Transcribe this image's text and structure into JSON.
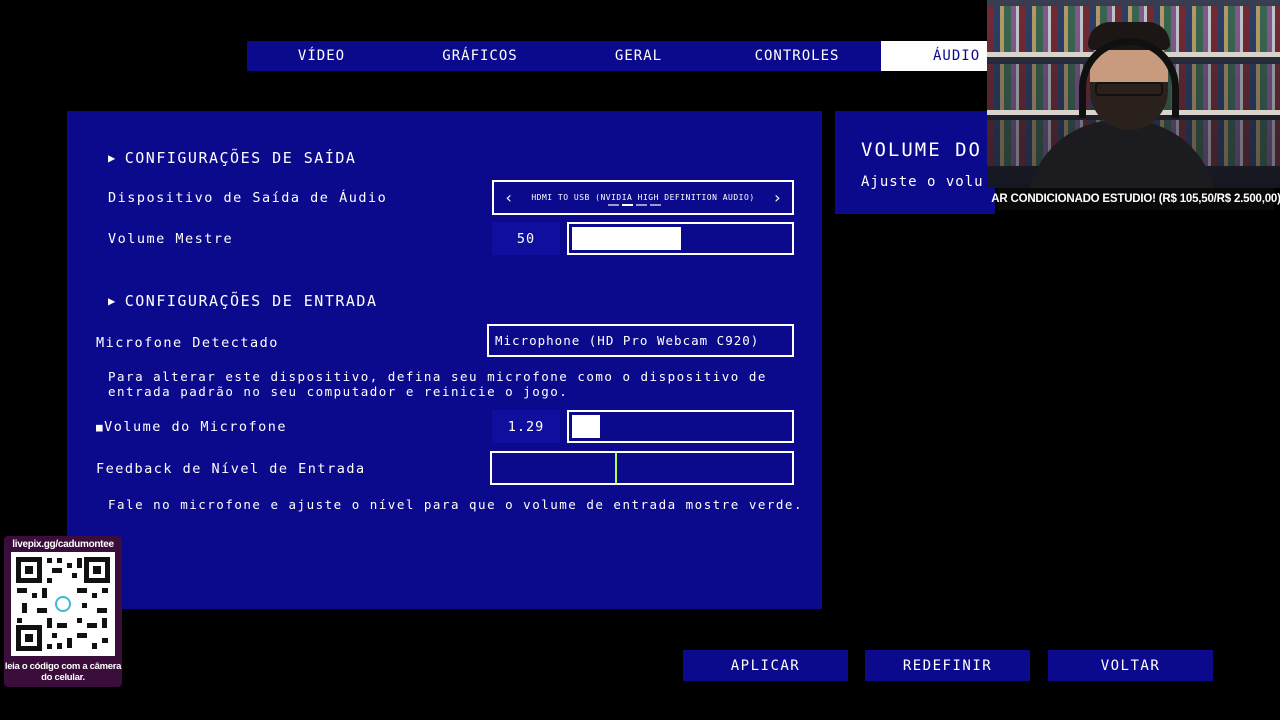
{
  "tabs": [
    {
      "label": "VÍDEO"
    },
    {
      "label": "GRÁFICOS"
    },
    {
      "label": "GERAL"
    },
    {
      "label": "CONTROLES"
    },
    {
      "label": "ÁUDIO",
      "active": true
    }
  ],
  "side_panel": {
    "title": "VOLUME DO",
    "description": "Ajuste o volu"
  },
  "output": {
    "header": "CONFIGURAÇÕES DE SAÍDA",
    "device_label": "Dispositivo de Saída de Áudio",
    "device_value": "HDMI TO USB (NVIDIA HIGH DEFINITION AUDIO)",
    "device_prev_icon": "‹",
    "device_next_icon": "›",
    "master_label": "Volume Mestre",
    "master_value": "50",
    "master_fraction": 0.5
  },
  "input": {
    "header": "CONFIGURAÇÕES DE ENTRADA",
    "mic_label": "Microfone Detectado",
    "mic_value": "Microphone (HD Pro Webcam C920)",
    "mic_note": "Para alterar este dispositivo, defina seu microfone como o dispositivo de entrada padrão no seu computador e reinicie o jogo.",
    "mic_volume_marker": "■",
    "mic_volume_label": "Volume do Microfone",
    "mic_volume_value": "1.29",
    "mic_volume_fraction": 0.13,
    "feedback_label": "Feedback de Nível de Entrada",
    "feedback_fraction": 0.41,
    "feedback_note": "Fale no microfone e ajuste o nível para que o volume de entrada mostre verde."
  },
  "buttons": {
    "apply": "APLICAR",
    "reset": "REDEFINIR",
    "back": "VOLTAR"
  },
  "stream": {
    "banner": "AR CONDICIONADO ESTUDIO! (R$ 105,50/R$ 2.500,00)",
    "qr_url": "livepix.gg/cadumontee",
    "qr_caption": "leia o código com a câmera do celular."
  },
  "colors": {
    "panel": "#0c0a8c",
    "background": "#000000",
    "meter_ok": "#aaff44"
  }
}
